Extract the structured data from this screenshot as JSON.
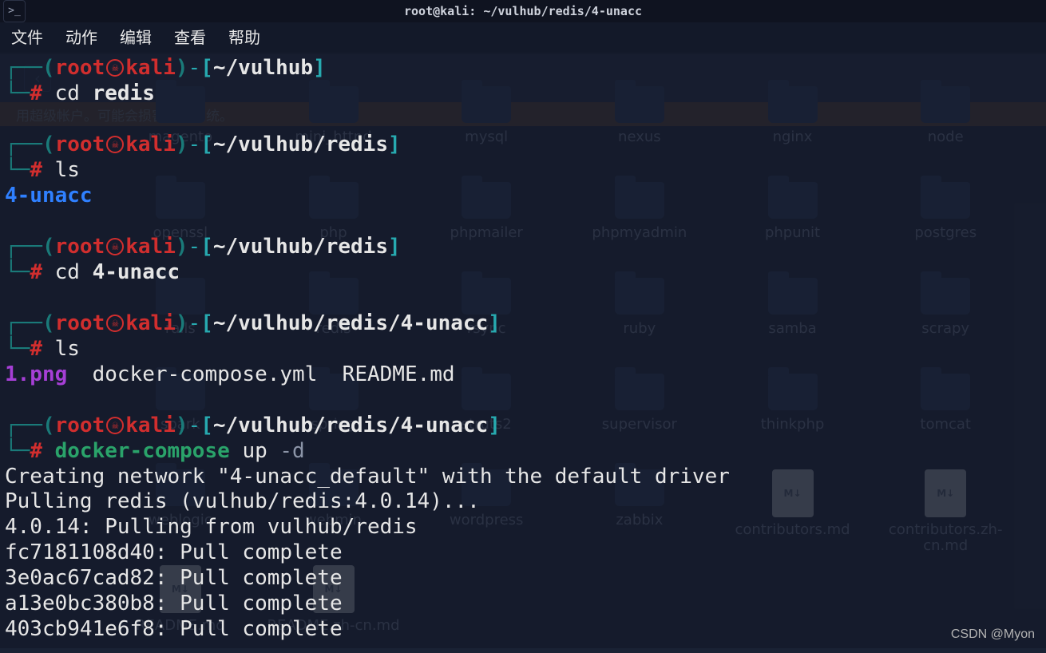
{
  "window": {
    "title": "root@kali: ~/vulhub/redis/4-unacc"
  },
  "menu": {
    "file": "文件",
    "action": "动作",
    "edit": "编辑",
    "view": "查看",
    "help": "帮助"
  },
  "bg": {
    "warning": "用超级帐户。可能会损害您的系统。",
    "rows": [
      [
        "magento",
        "mini_httpd",
        "mysql",
        "nexus",
        "nginx",
        "node"
      ],
      [
        "openssl",
        "php",
        "phpmailer",
        "phpmyadmin",
        "phpunit",
        "postgres"
      ],
      [
        "rails",
        "redis",
        "rsync",
        "ruby",
        "samba",
        "scrapy"
      ],
      [
        "spark",
        "spring",
        "struts2",
        "supervisor",
        "thinkphp",
        "tomcat"
      ],
      [
        "weblogic",
        "webmin",
        "wordpress",
        "zabbix",
        "contributors.md",
        "contributors.zh-cn.md"
      ],
      [
        "README.md",
        "README.zh-cn.md",
        "",
        "",
        "",
        ""
      ]
    ]
  },
  "prompt": {
    "user": "root",
    "host": "kali",
    "p1": "~/vulhub",
    "p2": "~/vulhub/redis",
    "p3": "~/vulhub/redis/4-unacc"
  },
  "session": {
    "cmd1": "cd",
    "arg1": "redis",
    "cmd2": "ls",
    "out2": "4-unacc",
    "cmd3": "cd",
    "arg3": "4-unacc",
    "cmd4": "ls",
    "out4_a": "1.png",
    "out4_b": "docker-compose.yml",
    "out4_c": "README.md",
    "cmd5": "docker-compose",
    "cmd5_a": "up",
    "cmd5_f": "-d",
    "l1": "Creating network \"4-unacc_default\" with the default driver",
    "l2": "Pulling redis (vulhub/redis:4.0.14)...",
    "l3": "4.0.14: Pulling from vulhub/redis",
    "l4": "fc7181108d40: Pull complete",
    "l5": "3e0ac67cad82: Pull complete",
    "l6": "a13e0bc380b8: Pull complete",
    "l7": "403cb941e6f8: Pull complete"
  },
  "watermark": "CSDN @Myon⁣"
}
